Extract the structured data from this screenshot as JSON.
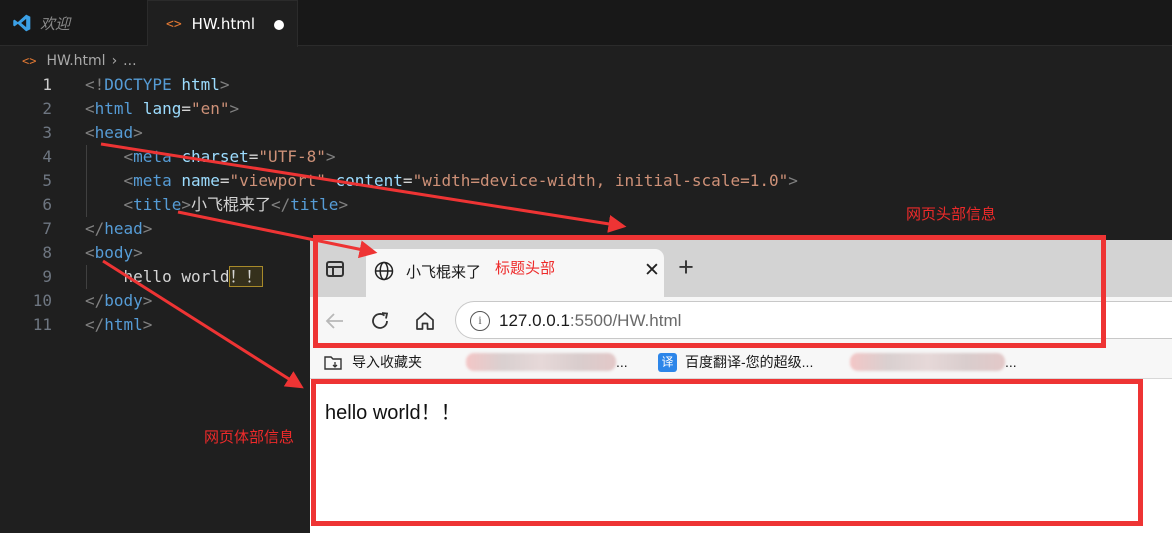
{
  "vscode": {
    "tabs": {
      "welcome": "欢迎",
      "active": "HW.html"
    },
    "breadcrumb": {
      "file": "HW.html",
      "rest": "..."
    },
    "code_lines": [
      {
        "num": "1",
        "tokens": [
          {
            "c": "p",
            "t": "<!"
          },
          {
            "c": "t",
            "t": "DOCTYPE"
          },
          {
            "c": "x",
            "t": " "
          },
          {
            "c": "a",
            "t": "html"
          },
          {
            "c": "p",
            "t": ">"
          }
        ]
      },
      {
        "num": "2",
        "tokens": [
          {
            "c": "p",
            "t": "<"
          },
          {
            "c": "t",
            "t": "html"
          },
          {
            "c": "x",
            "t": " "
          },
          {
            "c": "a",
            "t": "lang"
          },
          {
            "c": "x",
            "t": "="
          },
          {
            "c": "s",
            "t": "\"en\""
          },
          {
            "c": "p",
            "t": ">"
          }
        ]
      },
      {
        "num": "3",
        "tokens": [
          {
            "c": "p",
            "t": "<"
          },
          {
            "c": "t",
            "t": "head"
          },
          {
            "c": "p",
            "t": ">"
          }
        ]
      },
      {
        "num": "4",
        "tokens": [
          {
            "c": "x",
            "t": "    "
          },
          {
            "c": "p",
            "t": "<"
          },
          {
            "c": "t",
            "t": "meta"
          },
          {
            "c": "x",
            "t": " "
          },
          {
            "c": "a",
            "t": "charset"
          },
          {
            "c": "x",
            "t": "="
          },
          {
            "c": "s",
            "t": "\"UTF-8\""
          },
          {
            "c": "p",
            "t": ">"
          }
        ]
      },
      {
        "num": "5",
        "tokens": [
          {
            "c": "x",
            "t": "    "
          },
          {
            "c": "p",
            "t": "<"
          },
          {
            "c": "t",
            "t": "meta"
          },
          {
            "c": "x",
            "t": " "
          },
          {
            "c": "a",
            "t": "name"
          },
          {
            "c": "x",
            "t": "="
          },
          {
            "c": "s",
            "t": "\"viewport\""
          },
          {
            "c": "x",
            "t": " "
          },
          {
            "c": "a",
            "t": "content"
          },
          {
            "c": "x",
            "t": "="
          },
          {
            "c": "s",
            "t": "\"width=device-width, initial-scale=1.0\""
          },
          {
            "c": "p",
            "t": ">"
          }
        ]
      },
      {
        "num": "6",
        "tokens": [
          {
            "c": "x",
            "t": "    "
          },
          {
            "c": "p",
            "t": "<"
          },
          {
            "c": "t",
            "t": "title"
          },
          {
            "c": "p",
            "t": ">"
          },
          {
            "c": "x",
            "t": "小飞棍来了"
          },
          {
            "c": "p",
            "t": "</"
          },
          {
            "c": "t",
            "t": "title"
          },
          {
            "c": "p",
            "t": ">"
          }
        ]
      },
      {
        "num": "7",
        "tokens": [
          {
            "c": "p",
            "t": "</"
          },
          {
            "c": "t",
            "t": "head"
          },
          {
            "c": "p",
            "t": ">"
          }
        ]
      },
      {
        "num": "8",
        "tokens": [
          {
            "c": "p",
            "t": "<"
          },
          {
            "c": "t",
            "t": "body"
          },
          {
            "c": "p",
            "t": ">"
          }
        ]
      },
      {
        "num": "9",
        "tokens": [
          {
            "c": "x",
            "t": "    hello world"
          },
          {
            "c": "hl",
            "t": "！！"
          }
        ]
      },
      {
        "num": "10",
        "tokens": [
          {
            "c": "p",
            "t": "</"
          },
          {
            "c": "t",
            "t": "body"
          },
          {
            "c": "p",
            "t": ">"
          }
        ]
      },
      {
        "num": "11",
        "tokens": [
          {
            "c": "p",
            "t": "</"
          },
          {
            "c": "t",
            "t": "html"
          },
          {
            "c": "p",
            "t": ">"
          }
        ]
      }
    ],
    "current_line": "1"
  },
  "browser": {
    "tab_title": "小飞棍来了",
    "url_host": "127.0.0.1",
    "url_rest": ":5500/HW.html",
    "bookmarks": {
      "import": "导入收藏夹",
      "ellipsis1": "...",
      "fy_icon": "译",
      "fanyi": "百度翻译-您的超级...",
      "ellipsis2": "..."
    },
    "content_text": "hello world！！"
  },
  "annotations": {
    "tab_label": "标题头部",
    "head_label": "网页头部信息",
    "body_label": "网页体部信息",
    "color": "#ee2a2a"
  }
}
